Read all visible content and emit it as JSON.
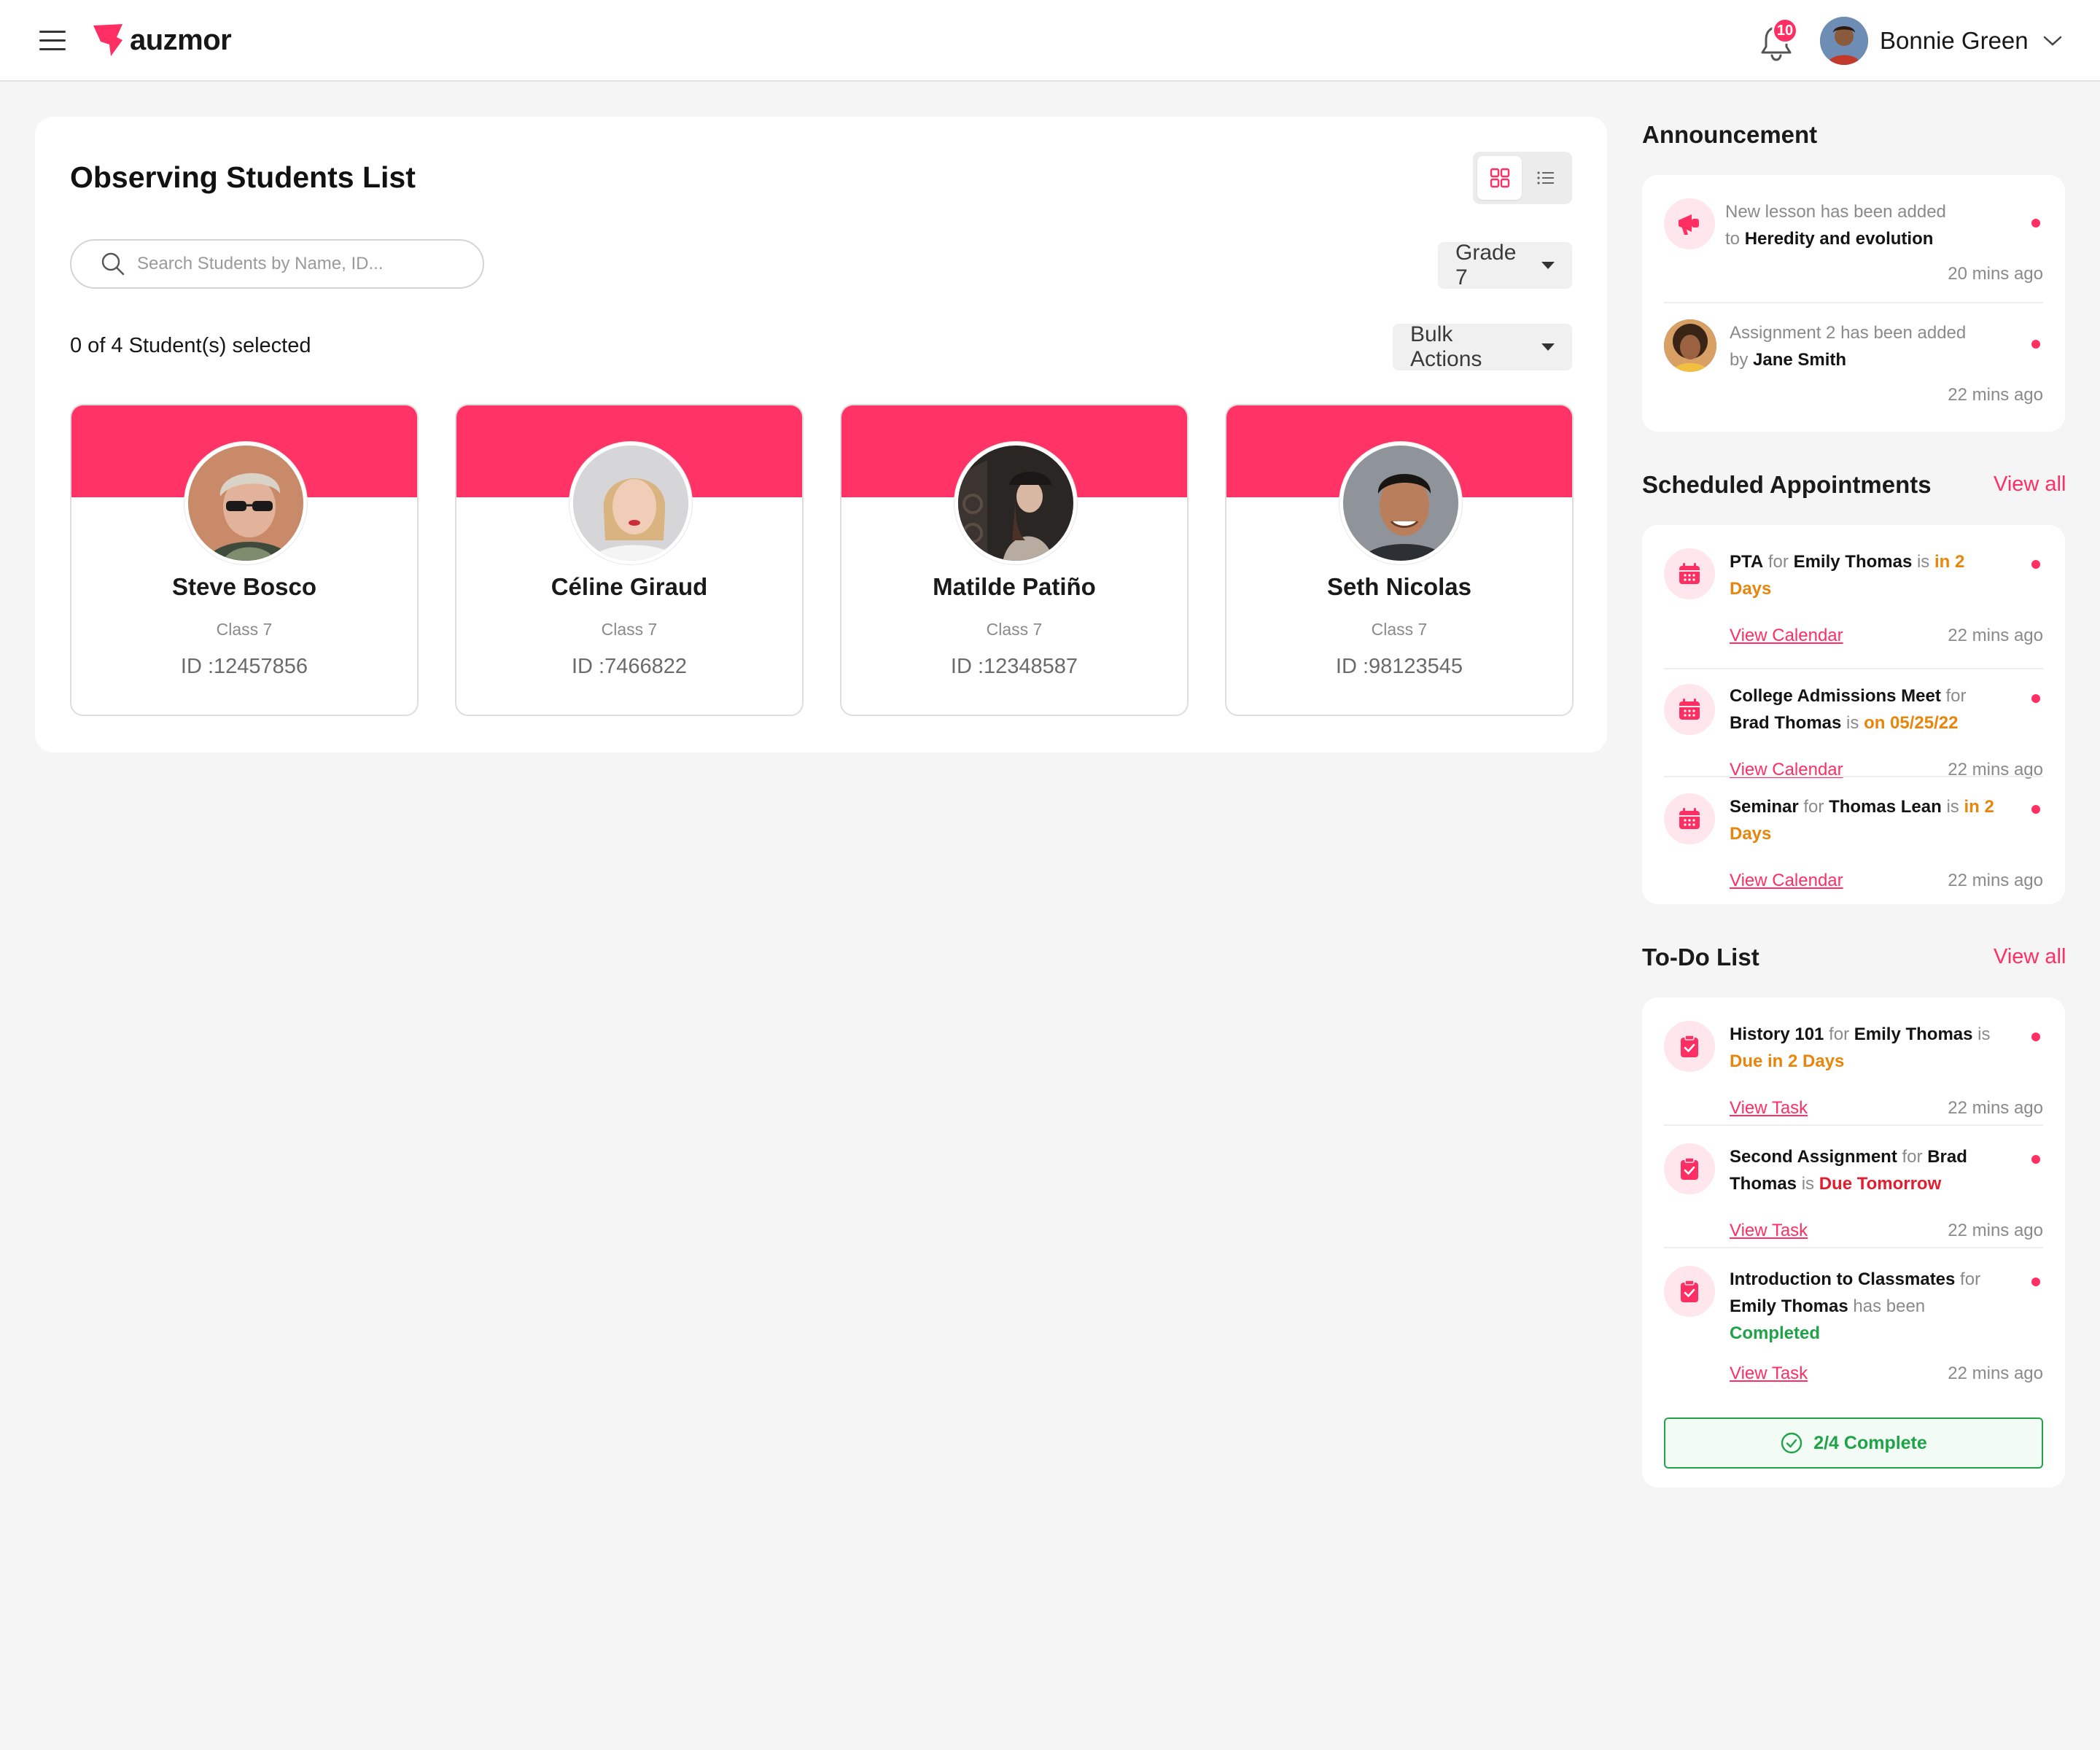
{
  "header": {
    "brand": "auzmor",
    "notification_count": "10",
    "user_name": "Bonnie Green"
  },
  "main": {
    "title": "Observing Students List",
    "search_placeholder": "Search Students by Name, ID...",
    "grade_label": "Grade 7",
    "selected_text": "0 of 4 Student(s) selected",
    "bulk_label": "Bulk Actions",
    "students": [
      {
        "name": "Steve Bosco",
        "class": "Class 7",
        "id": "ID :12457856"
      },
      {
        "name": "Céline Giraud",
        "class": "Class 7",
        "id": "ID :7466822"
      },
      {
        "name": "Matilde Patiño",
        "class": "Class 7",
        "id": "ID :12348587"
      },
      {
        "name": "Seth Nicolas",
        "class": "Class 7",
        "id": "ID :98123545"
      }
    ]
  },
  "announcement": {
    "title": "Announcement",
    "items": [
      {
        "text_a": "New lesson has been added",
        "text_b": "to",
        "bold": "Heredity and evolution",
        "time": "20 mins ago"
      },
      {
        "text_a": "Assignment 2 has been added",
        "text_b": "by",
        "bold": "Jane Smith",
        "time": "22 mins ago"
      }
    ]
  },
  "appointments": {
    "title": "Scheduled Appointments",
    "view_all": "View all",
    "items": [
      {
        "event": "PTA",
        "for": "for",
        "person": "Emily Thomas",
        "is": "is",
        "when": "in 2 Days",
        "link": "View Calendar",
        "time": "22 mins ago"
      },
      {
        "event": "College Admissions Meet",
        "for": "for",
        "person": "Brad Thomas",
        "is": "is",
        "when": "on 05/25/22",
        "link": "View Calendar",
        "time": "22 mins ago"
      },
      {
        "event": "Seminar",
        "for": "for",
        "person": "Thomas Lean",
        "is": "is",
        "when": "in 2 Days",
        "link": "View Calendar",
        "time": "22 mins ago"
      }
    ]
  },
  "todo": {
    "title": "To-Do List",
    "view_all": "View all",
    "items": [
      {
        "task": "History 101",
        "for": "for",
        "person": "Emily Thomas",
        "is": "is",
        "status": "Due in 2 Days",
        "link": "View Task",
        "time": "22 mins ago"
      },
      {
        "task": "Second Assignment",
        "for": "for",
        "person": "Brad Thomas",
        "is": "is",
        "status": "Due Tomorrow",
        "link": "View Task",
        "time": "22 mins ago"
      },
      {
        "task": "Introduction to Classmates",
        "for": "for",
        "person": "Emily Thomas",
        "is": "has been",
        "status": "Completed",
        "link": "View Task",
        "time": "22 mins ago"
      }
    ],
    "progress_label": "2/4 Complete",
    "progress_done": 2,
    "progress_total": 4
  },
  "colors": {
    "accent": "#ff2e63",
    "banner": "#ff3366",
    "warning": "#e8850a",
    "danger": "#e21d2e",
    "success": "#1fa348"
  },
  "icons": [
    "menu-icon",
    "logo-icon",
    "bell-icon",
    "chevron-down-icon",
    "grid-view-icon",
    "list-view-icon",
    "search-icon",
    "megaphone-icon",
    "calendar-icon",
    "clipboard-check-icon",
    "check-circle-icon"
  ]
}
